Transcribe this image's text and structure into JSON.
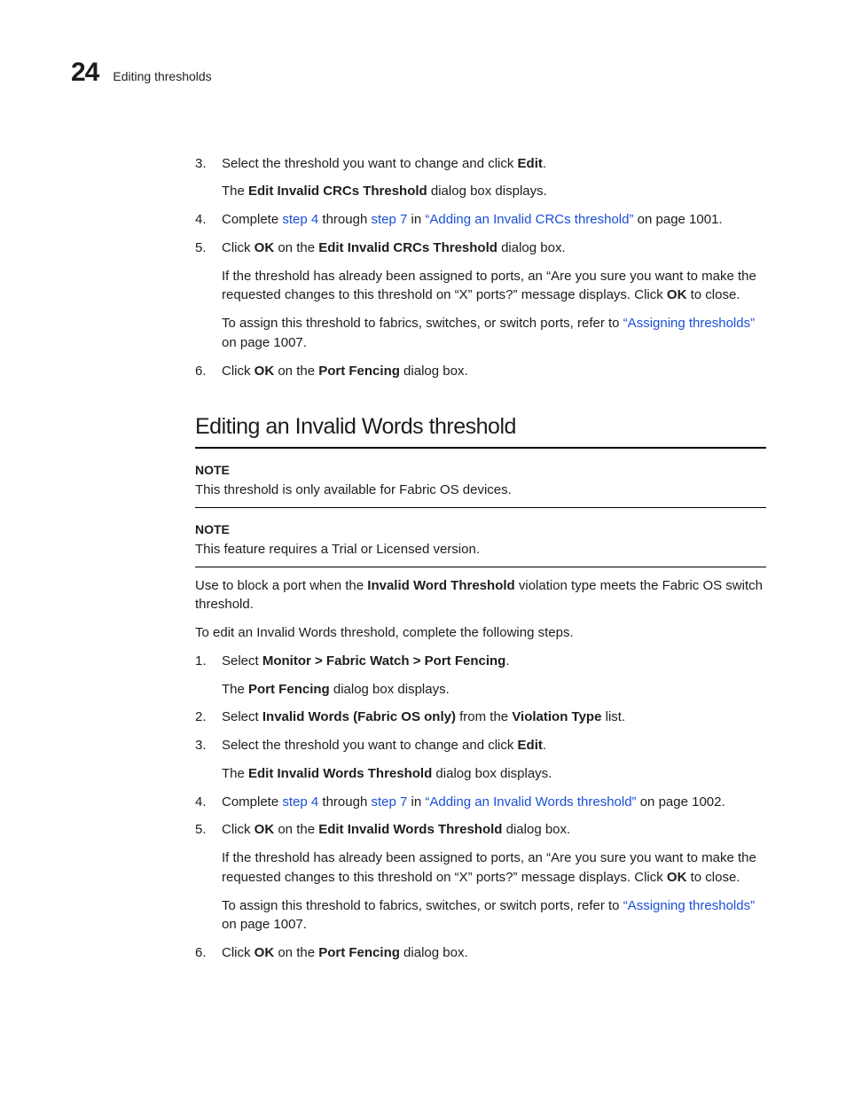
{
  "header": {
    "chapter": "24",
    "running": "Editing thresholds"
  },
  "topA": {
    "s3_prefix": "Select the threshold you want to change and click ",
    "s3_bold": "Edit",
    "s3_tail": ".",
    "s3_sub_prefix": "The ",
    "s3_sub_bold": "Edit Invalid CRCs Threshold",
    "s3_sub_tail": " dialog box displays.",
    "s4_prefix": "Complete ",
    "s4_link1": "step 4",
    "s4_mid1": " through ",
    "s4_link2": "step 7",
    "s4_mid2": " in ",
    "s4_link3": "“Adding an Invalid CRCs threshold”",
    "s4_tail": " on page 1001.",
    "s5_prefix": "Click ",
    "s5_bold1": "OK",
    "s5_mid": " on the ",
    "s5_bold2": "Edit Invalid CRCs Threshold",
    "s5_tail": " dialog box.",
    "s5_p1a": "If the threshold has already been assigned to ports, an “Are you sure you want to make the requested changes to this threshold on “X” ports?” message displays. Click ",
    "s5_p1_bold": "OK",
    "s5_p1b": " to close.",
    "s5_p2a": "To assign this threshold to fabrics, switches, or switch ports, refer to ",
    "s5_p2_link": "“Assigning thresholds”",
    "s5_p2b": " on page 1007.",
    "s6_prefix": "Click ",
    "s6_bold1": "OK",
    "s6_mid": " on the ",
    "s6_bold2": "Port Fencing",
    "s6_tail": " dialog box."
  },
  "topic": {
    "title": "Editing an Invalid Words threshold",
    "note_label": "NOTE",
    "note1": "This threshold is only available for Fabric OS devices.",
    "note2": "This feature requires a Trial or Licensed version.",
    "intro_a": "Use to block a port when the ",
    "intro_bold": "Invalid Word Threshold",
    "intro_b": " violation type meets the Fabric OS switch threshold.",
    "lead": "To edit an Invalid Words threshold, complete the following steps."
  },
  "stepsB": {
    "s1_prefix": "Select ",
    "s1_bold": "Monitor > Fabric Watch > Port Fencing",
    "s1_tail": ".",
    "s1_sub_prefix": "The ",
    "s1_sub_bold": "Port Fencing",
    "s1_sub_tail": " dialog box displays.",
    "s2_prefix": "Select ",
    "s2_bold1": "Invalid Words (Fabric OS only)",
    "s2_mid": " from the ",
    "s2_bold2": "Violation Type",
    "s2_tail": " list.",
    "s3_prefix": "Select the threshold you want to change and click ",
    "s3_bold": "Edit",
    "s3_tail": ".",
    "s3_sub_prefix": "The ",
    "s3_sub_bold": "Edit Invalid Words Threshold",
    "s3_sub_tail": " dialog box displays.",
    "s4_prefix": "Complete ",
    "s4_link1": "step 4",
    "s4_mid1": " through ",
    "s4_link2": "step 7",
    "s4_mid2": " in ",
    "s4_link3": "“Adding an Invalid Words threshold”",
    "s4_tail": " on page 1002.",
    "s5_prefix": "Click ",
    "s5_bold1": "OK",
    "s5_mid": " on the ",
    "s5_bold2": "Edit Invalid Words Threshold",
    "s5_tail": " dialog box.",
    "s5_p1a": "If the threshold has already been assigned to ports, an “Are you sure you want to make the requested changes to this threshold on “X” ports?” message displays. Click ",
    "s5_p1_bold": "OK",
    "s5_p1b": " to close.",
    "s5_p2a": "To assign this threshold to fabrics, switches, or switch ports, refer to ",
    "s5_p2_link": "“Assigning thresholds”",
    "s5_p2b": " on page 1007.",
    "s6_prefix": "Click ",
    "s6_bold1": "OK",
    "s6_mid": " on the ",
    "s6_bold2": "Port Fencing",
    "s6_tail": " dialog box."
  }
}
